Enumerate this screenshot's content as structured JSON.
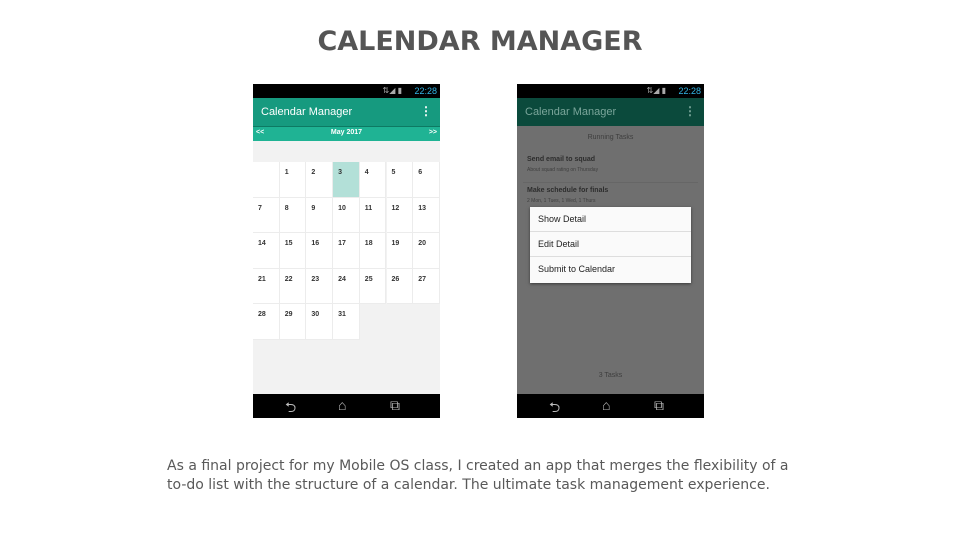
{
  "slide": {
    "title": "CALENDAR MANAGER",
    "caption": "As a final project for my Mobile OS class, I created an app that merges the flexibility of a to-do list with the structure of a calendar. The ultimate task management experience."
  },
  "phone1": {
    "status_icons": "⇅◢ ▮",
    "clock": "22:28",
    "app_title": "Calendar Manager",
    "menu_icon": "⋮",
    "prev_label": "<<",
    "next_label": ">>",
    "month": "May 2017",
    "days": [
      "1",
      "2",
      "3",
      "4",
      "5",
      "6",
      "7",
      "8",
      "9",
      "10",
      "11",
      "12",
      "13",
      "14",
      "15",
      "16",
      "17",
      "18",
      "19",
      "20",
      "21",
      "22",
      "23",
      "24",
      "25",
      "26",
      "27",
      "28",
      "29",
      "30",
      "31"
    ],
    "selected_day": "3"
  },
  "phone2": {
    "status_icons": "⇅◢ ▮",
    "clock": "22:28",
    "app_title": "Calendar Manager",
    "menu_icon": "⋮",
    "heading": "Running Tasks",
    "tasks": [
      {
        "title": "Send email to squad",
        "detail": "About squad rating on Thursday"
      },
      {
        "title": "Make schedule for finals",
        "detail": "2 Mon, 1 Tues, 1 Wed, 1 Thurs"
      }
    ],
    "menu_items": [
      "Show Detail",
      "Edit Detail",
      "Submit to Calendar"
    ],
    "count": "3 Tasks"
  },
  "nav": {
    "back": "⮌",
    "home": "⌂",
    "recents": "⧉"
  },
  "colors": {
    "appbar": "#169a7f",
    "monthbar": "#1fb394",
    "selected": "#b3e0d8"
  }
}
